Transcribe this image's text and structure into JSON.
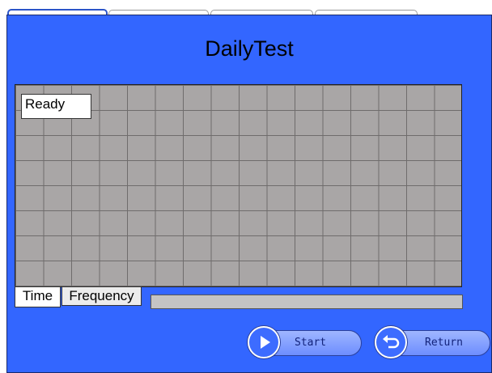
{
  "window": {
    "title": "DailyTest"
  },
  "status": {
    "text": "Ready"
  },
  "mode_tabs": [
    {
      "label": "Time",
      "active": true
    },
    {
      "label": "Frequency",
      "active": false
    }
  ],
  "progress": {
    "value_percent": 0
  },
  "buttons": {
    "start": {
      "label": "Start",
      "icon": "play-icon"
    },
    "return": {
      "label": "Return",
      "icon": "return-arrow-icon"
    }
  },
  "colors": {
    "panel_bg": "#3366ff",
    "plot_bg": "#a9a6a6",
    "button_bg": "#8aa4ff"
  }
}
